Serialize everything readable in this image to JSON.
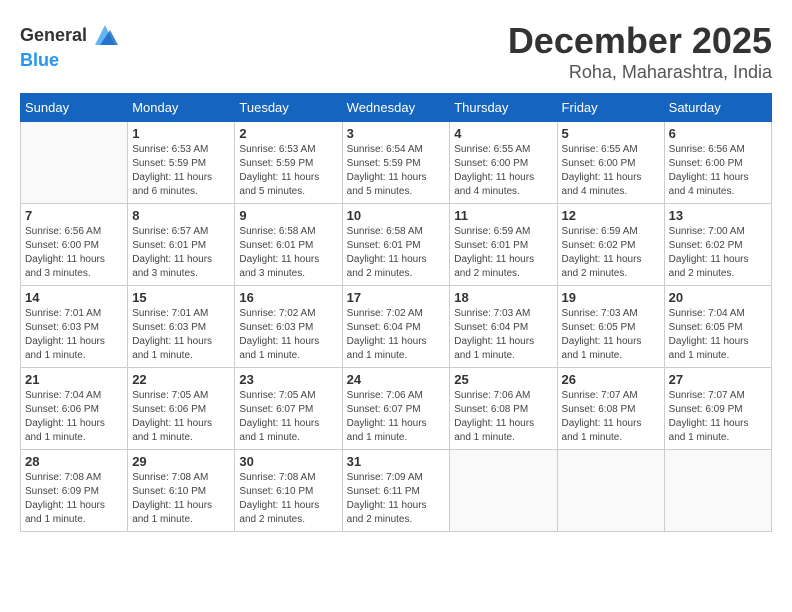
{
  "logo": {
    "text_general": "General",
    "text_blue": "Blue"
  },
  "header": {
    "month": "December 2025",
    "location": "Roha, Maharashtra, India"
  },
  "weekdays": [
    "Sunday",
    "Monday",
    "Tuesday",
    "Wednesday",
    "Thursday",
    "Friday",
    "Saturday"
  ],
  "weeks": [
    [
      {
        "day": "",
        "info": ""
      },
      {
        "day": "1",
        "info": "Sunrise: 6:53 AM\nSunset: 5:59 PM\nDaylight: 11 hours and 6 minutes."
      },
      {
        "day": "2",
        "info": "Sunrise: 6:53 AM\nSunset: 5:59 PM\nDaylight: 11 hours and 5 minutes."
      },
      {
        "day": "3",
        "info": "Sunrise: 6:54 AM\nSunset: 5:59 PM\nDaylight: 11 hours and 5 minutes."
      },
      {
        "day": "4",
        "info": "Sunrise: 6:55 AM\nSunset: 6:00 PM\nDaylight: 11 hours and 4 minutes."
      },
      {
        "day": "5",
        "info": "Sunrise: 6:55 AM\nSunset: 6:00 PM\nDaylight: 11 hours and 4 minutes."
      },
      {
        "day": "6",
        "info": "Sunrise: 6:56 AM\nSunset: 6:00 PM\nDaylight: 11 hours and 4 minutes."
      }
    ],
    [
      {
        "day": "7",
        "info": "Sunrise: 6:56 AM\nSunset: 6:00 PM\nDaylight: 11 hours and 3 minutes."
      },
      {
        "day": "8",
        "info": "Sunrise: 6:57 AM\nSunset: 6:01 PM\nDaylight: 11 hours and 3 minutes."
      },
      {
        "day": "9",
        "info": "Sunrise: 6:58 AM\nSunset: 6:01 PM\nDaylight: 11 hours and 3 minutes."
      },
      {
        "day": "10",
        "info": "Sunrise: 6:58 AM\nSunset: 6:01 PM\nDaylight: 11 hours and 2 minutes."
      },
      {
        "day": "11",
        "info": "Sunrise: 6:59 AM\nSunset: 6:01 PM\nDaylight: 11 hours and 2 minutes."
      },
      {
        "day": "12",
        "info": "Sunrise: 6:59 AM\nSunset: 6:02 PM\nDaylight: 11 hours and 2 minutes."
      },
      {
        "day": "13",
        "info": "Sunrise: 7:00 AM\nSunset: 6:02 PM\nDaylight: 11 hours and 2 minutes."
      }
    ],
    [
      {
        "day": "14",
        "info": "Sunrise: 7:01 AM\nSunset: 6:03 PM\nDaylight: 11 hours and 1 minute."
      },
      {
        "day": "15",
        "info": "Sunrise: 7:01 AM\nSunset: 6:03 PM\nDaylight: 11 hours and 1 minute."
      },
      {
        "day": "16",
        "info": "Sunrise: 7:02 AM\nSunset: 6:03 PM\nDaylight: 11 hours and 1 minute."
      },
      {
        "day": "17",
        "info": "Sunrise: 7:02 AM\nSunset: 6:04 PM\nDaylight: 11 hours and 1 minute."
      },
      {
        "day": "18",
        "info": "Sunrise: 7:03 AM\nSunset: 6:04 PM\nDaylight: 11 hours and 1 minute."
      },
      {
        "day": "19",
        "info": "Sunrise: 7:03 AM\nSunset: 6:05 PM\nDaylight: 11 hours and 1 minute."
      },
      {
        "day": "20",
        "info": "Sunrise: 7:04 AM\nSunset: 6:05 PM\nDaylight: 11 hours and 1 minute."
      }
    ],
    [
      {
        "day": "21",
        "info": "Sunrise: 7:04 AM\nSunset: 6:06 PM\nDaylight: 11 hours and 1 minute."
      },
      {
        "day": "22",
        "info": "Sunrise: 7:05 AM\nSunset: 6:06 PM\nDaylight: 11 hours and 1 minute."
      },
      {
        "day": "23",
        "info": "Sunrise: 7:05 AM\nSunset: 6:07 PM\nDaylight: 11 hours and 1 minute."
      },
      {
        "day": "24",
        "info": "Sunrise: 7:06 AM\nSunset: 6:07 PM\nDaylight: 11 hours and 1 minute."
      },
      {
        "day": "25",
        "info": "Sunrise: 7:06 AM\nSunset: 6:08 PM\nDaylight: 11 hours and 1 minute."
      },
      {
        "day": "26",
        "info": "Sunrise: 7:07 AM\nSunset: 6:08 PM\nDaylight: 11 hours and 1 minute."
      },
      {
        "day": "27",
        "info": "Sunrise: 7:07 AM\nSunset: 6:09 PM\nDaylight: 11 hours and 1 minute."
      }
    ],
    [
      {
        "day": "28",
        "info": "Sunrise: 7:08 AM\nSunset: 6:09 PM\nDaylight: 11 hours and 1 minute."
      },
      {
        "day": "29",
        "info": "Sunrise: 7:08 AM\nSunset: 6:10 PM\nDaylight: 11 hours and 1 minute."
      },
      {
        "day": "30",
        "info": "Sunrise: 7:08 AM\nSunset: 6:10 PM\nDaylight: 11 hours and 2 minutes."
      },
      {
        "day": "31",
        "info": "Sunrise: 7:09 AM\nSunset: 6:11 PM\nDaylight: 11 hours and 2 minutes."
      },
      {
        "day": "",
        "info": ""
      },
      {
        "day": "",
        "info": ""
      },
      {
        "day": "",
        "info": ""
      }
    ]
  ]
}
